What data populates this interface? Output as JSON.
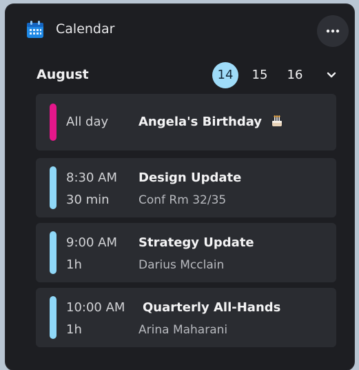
{
  "app": {
    "title": "Calendar",
    "icons": {
      "app": "calendar-icon",
      "more": "more-horizontal-icon",
      "expand": "chevron-down-icon"
    }
  },
  "date_nav": {
    "month": "August",
    "days": [
      "14",
      "15",
      "16"
    ],
    "selected_day": "14"
  },
  "events": [
    {
      "time": "All day",
      "duration": "",
      "title": "Angela's Birthday",
      "detail": "",
      "icon": "birthday-cake-icon",
      "color": "#e5178a"
    },
    {
      "time": "8:30 AM",
      "duration": "30 min",
      "title": "Design Update",
      "detail": "Conf Rm 32/35",
      "color": "#8fd8f8"
    },
    {
      "time": "9:00 AM",
      "duration": "1h",
      "title": "Strategy Update",
      "detail": "Darius Mcclain",
      "color": "#8fd8f8"
    },
    {
      "time": "10:00 AM",
      "duration": "1h",
      "title": "Quarterly All-Hands",
      "detail": "Arina Maharani",
      "color": "#8fd8f8"
    }
  ],
  "colors": {
    "accent": "#9fdcf9",
    "background": "#1d1e22",
    "card": "#2a2c31"
  }
}
